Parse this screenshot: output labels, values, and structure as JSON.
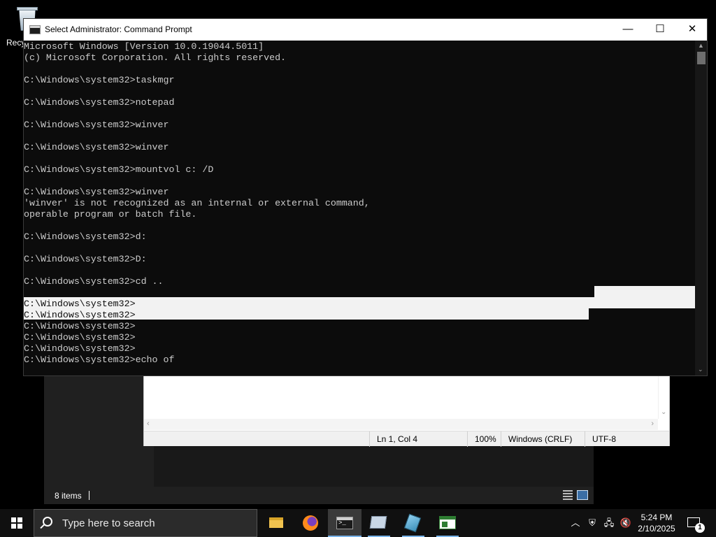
{
  "desktop": {
    "recycle_bin_label": "Recy"
  },
  "cmd": {
    "title": "Select Administrator: Command Prompt",
    "lines": [
      "Microsoft Windows [Version 10.0.19044.5011]",
      "(c) Microsoft Corporation. All rights reserved.",
      "",
      "C:\\Windows\\system32>taskmgr",
      "",
      "C:\\Windows\\system32>notepad",
      "",
      "C:\\Windows\\system32>winver",
      "",
      "C:\\Windows\\system32>winver",
      "",
      "C:\\Windows\\system32>mountvol c: /D",
      "",
      "C:\\Windows\\system32>winver",
      "'winver' is not recognized as an internal or external command,",
      "operable program or batch file.",
      "",
      "C:\\Windows\\system32>d:",
      "",
      "C:\\Windows\\system32>D:",
      "",
      "C:\\Windows\\system32>cd ..",
      "",
      "C:\\Windows\\system32>",
      "C:\\Windows\\system32>",
      "C:\\Windows\\system32>",
      "C:\\Windows\\system32>",
      "C:\\Windows\\system32>",
      "C:\\Windows\\system32>echo of"
    ],
    "minimize": "—",
    "maximize": "☐",
    "close": "✕"
  },
  "explorer": {
    "status": "8 items"
  },
  "notepad": {
    "position": "Ln 1, Col 4",
    "zoom": "100%",
    "line_ending": "Windows (CRLF)",
    "encoding": "UTF-8"
  },
  "taskbar": {
    "search_placeholder": "Type here to search",
    "time": "5:24 PM",
    "date": "2/10/2025",
    "notification_count": "1"
  }
}
